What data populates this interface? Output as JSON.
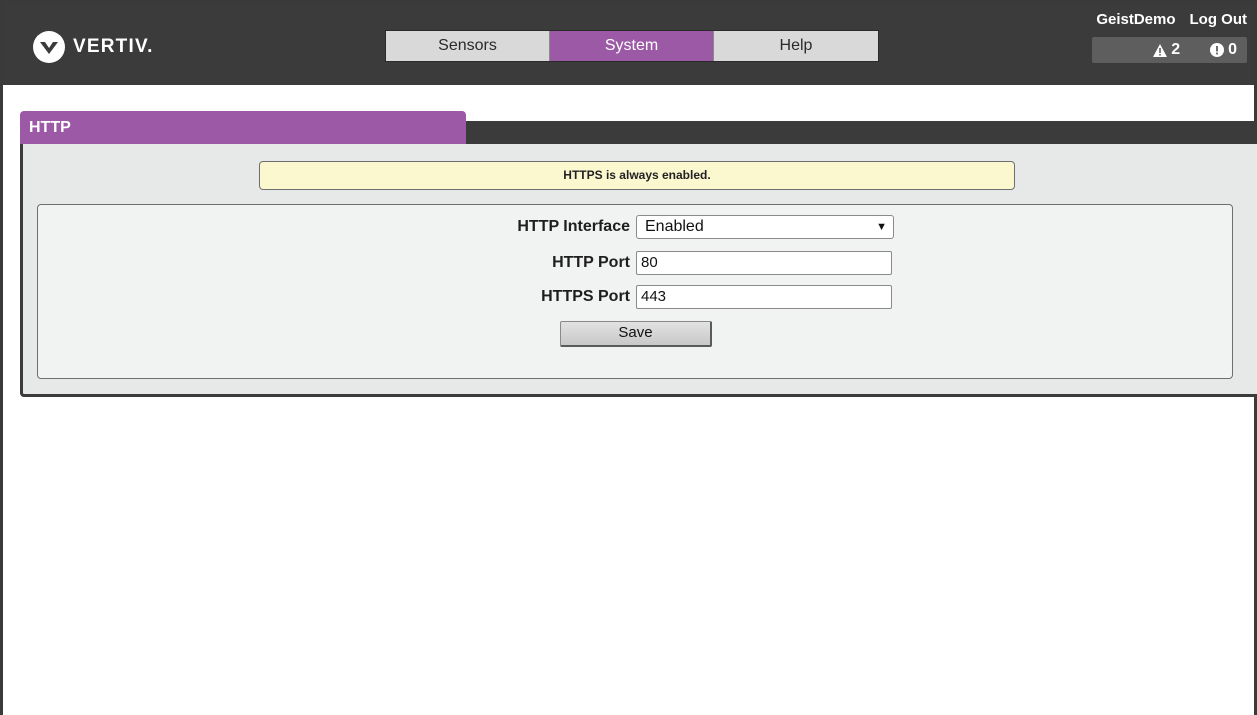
{
  "header": {
    "logo_text": "VERTIV",
    "logo_period": ".",
    "nav": [
      {
        "label": "Sensors"
      },
      {
        "label": "System"
      },
      {
        "label": "Help"
      }
    ],
    "user": "GeistDemo",
    "logout": "Log Out",
    "alerts": {
      "warning_count": "2",
      "alarm_count": "0"
    }
  },
  "panel": {
    "tab_label": "HTTP",
    "notice": "HTTPS is always enabled.",
    "fields": {
      "interface_label": "HTTP Interface",
      "interface_value": "Enabled",
      "http_port_label": "HTTP Port",
      "http_port_value": "80",
      "https_port_label": "HTTPS Port",
      "https_port_value": "443"
    },
    "save_label": "Save"
  },
  "colors": {
    "header_bg": "#3b3b3b",
    "accent": "#9b59a6",
    "notice_bg": "#fbf8d0",
    "panel_bg": "#e7e8e8"
  }
}
